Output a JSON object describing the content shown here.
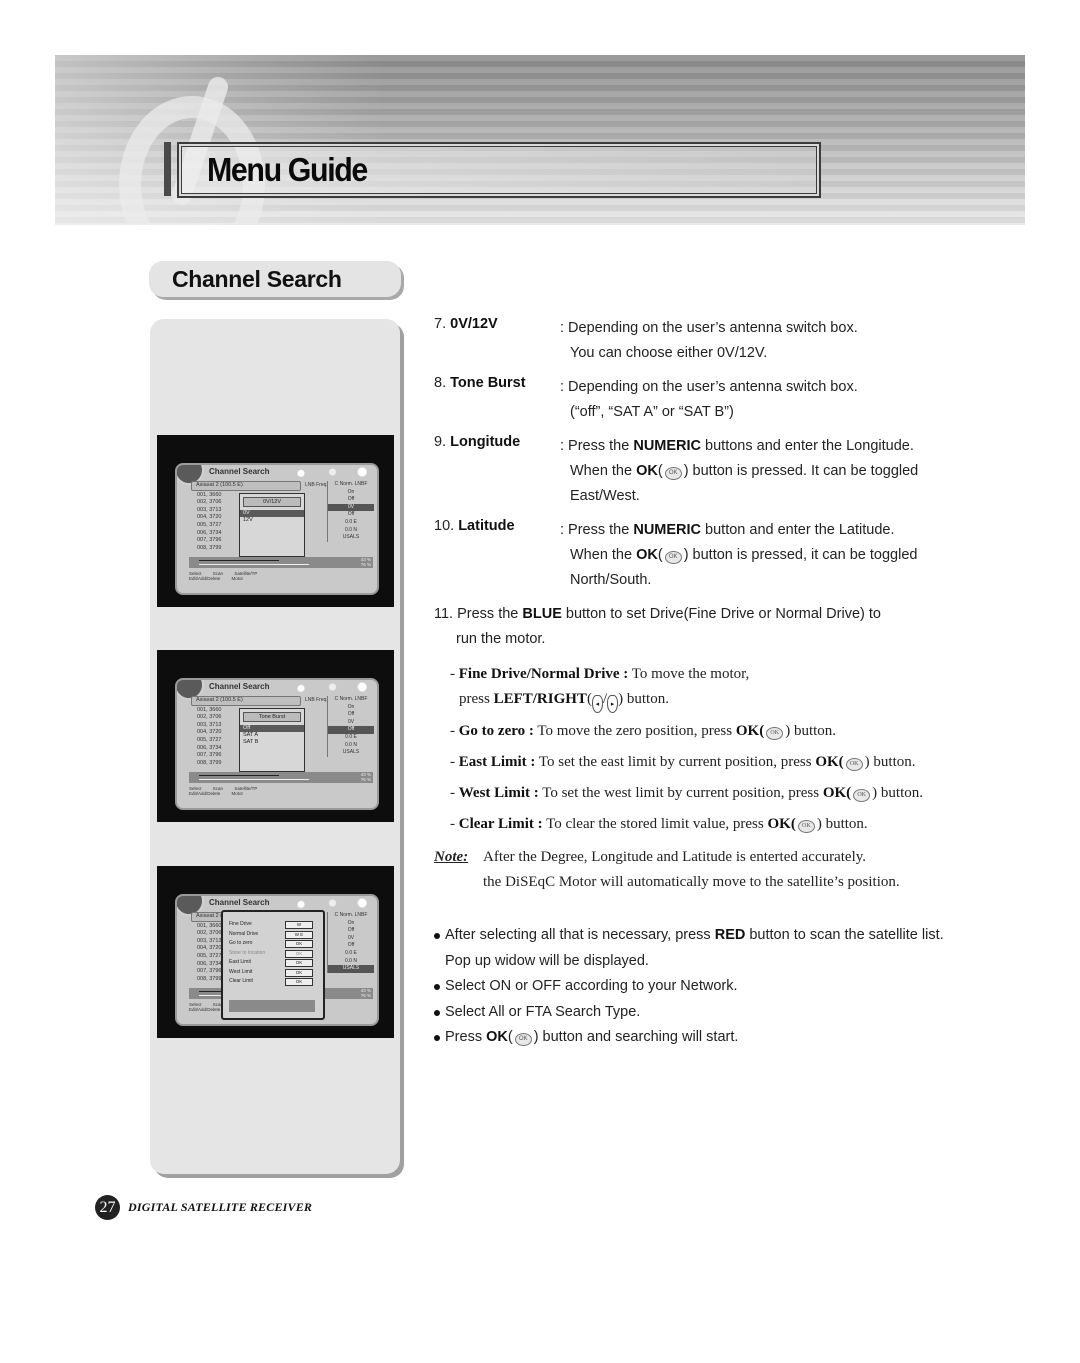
{
  "header": {
    "title": "Menu Guide"
  },
  "section": {
    "title": "Channel Search"
  },
  "screens": {
    "common": {
      "title": "Channel Search",
      "satellite": "Asiasat 2 (100.5 E)",
      "lnb_header": "LNB Freq.",
      "right_header": "C Norm. LNBF",
      "rows": [
        "001,  3660",
        "002,  3706",
        "003,  3713",
        "004,  3720",
        "005,  3727",
        "006,  3734",
        "007,  3796",
        "008,  3799"
      ],
      "right_values": [
        "On",
        "Off",
        "0V",
        "Off",
        "0.0 E",
        "0.0 N",
        "USALS"
      ],
      "signal_pct": [
        "43 %",
        "76 %"
      ],
      "legend": [
        "Select",
        "Scan",
        "Satellite/TP",
        "Edit/Add/Delete",
        "Motor"
      ]
    },
    "screen1": {
      "popup_title": "0V/12V",
      "options": [
        "0V",
        "12V"
      ],
      "selected": "0V"
    },
    "screen2": {
      "popup_title": "Tone Burst",
      "options": [
        "Off",
        "SAT A",
        "SAT B"
      ],
      "selected": "Off"
    },
    "screen3": {
      "rows": [
        {
          "label": "Fine Drive",
          "value": "W"
        },
        {
          "label": "Normal Drive",
          "value": "W   E"
        },
        {
          "label": "Go to zero",
          "value": "OK"
        },
        {
          "label": "Store to location",
          "value": "OK",
          "disabled": true
        },
        {
          "label": "East Limit",
          "value": "OK"
        },
        {
          "label": "West Limit",
          "value": "OK"
        },
        {
          "label": "Clear Limit",
          "value": "OK"
        }
      ],
      "signal_pct": [
        "43 %",
        "76 %"
      ]
    }
  },
  "items": [
    {
      "num": "7.",
      "label": "0V/12V",
      "lines": [
        ": Depending on the user’s antenna switch box.",
        "You can choose either 0V/12V."
      ]
    },
    {
      "num": "8.",
      "label": "Tone Burst",
      "lines": [
        ": Depending on the user’s antenna switch box.",
        "(“off”, “SAT A” or “SAT B”)"
      ]
    },
    {
      "num": "9.",
      "label": "Longitude",
      "line1_pre": ": Press the ",
      "line1_bold": "NUMERIC",
      "line1_post": " buttons and enter the Longitude.",
      "line2_pre": "When the ",
      "line2_bold": "OK",
      "line2_post": ") button is pressed. It can be toggled",
      "line3": "East/West."
    },
    {
      "num": "10.",
      "label": "Latitude",
      "line1_pre": ": Press the ",
      "line1_bold": "NUMERIC",
      "line1_post": " button and enter the Latitude.",
      "line2_pre": "When the ",
      "line2_bold": "OK",
      "line2_post": ") button is pressed, it can be toggled",
      "line3": "North/South."
    }
  ],
  "item11": {
    "pre": "11. Press the ",
    "bold": "BLUE",
    "post": " button to set Drive(Fine Drive or Normal Drive) to",
    "cont": "run the motor."
  },
  "motor_items": [
    {
      "label": "Fine Drive/Normal Drive :",
      "text": " To move the motor,",
      "cont_pre": "press ",
      "cont_bold": "LEFT/RIGHT",
      "cont_post": ") button."
    },
    {
      "label": "Go to zero :",
      "text": " To move the zero position, press ",
      "ok": "OK(",
      "end": ") button."
    },
    {
      "label": "East Limit :",
      "text": " To set the east limit by current position, press ",
      "ok": "OK(",
      "end": ") button."
    },
    {
      "label": "West Limit :",
      "text": " To set the west limit by current position, press ",
      "ok": "OK(",
      "end": ") button."
    },
    {
      "label": "Clear Limit :",
      "text": " To clear the stored limit value, press ",
      "ok": "OK(",
      "end": ") button."
    }
  ],
  "note": {
    "label": "Note:",
    "line1": "After the Degree, Longitude and Latitude is enterted accurately.",
    "line2": "the DiSEqC Motor will automatically move to the satellite’s position."
  },
  "bullets": [
    {
      "pre": "After selecting all that is necessary, press ",
      "bold": "RED",
      "post": " button to scan the satellite list.",
      "cont": "Pop up widow will be displayed."
    },
    {
      "text": "Select ON or OFF according to your Network."
    },
    {
      "text": "Select All or FTA Search Type."
    },
    {
      "pre": "Press ",
      "bold": "OK",
      "post": ") button and searching will start."
    }
  ],
  "icons": {
    "ok": "OK",
    "left": "◂",
    "right": "▸"
  },
  "footer": {
    "page_number": "27",
    "title": "DIGITAL SATELLITE RECEIVER"
  }
}
